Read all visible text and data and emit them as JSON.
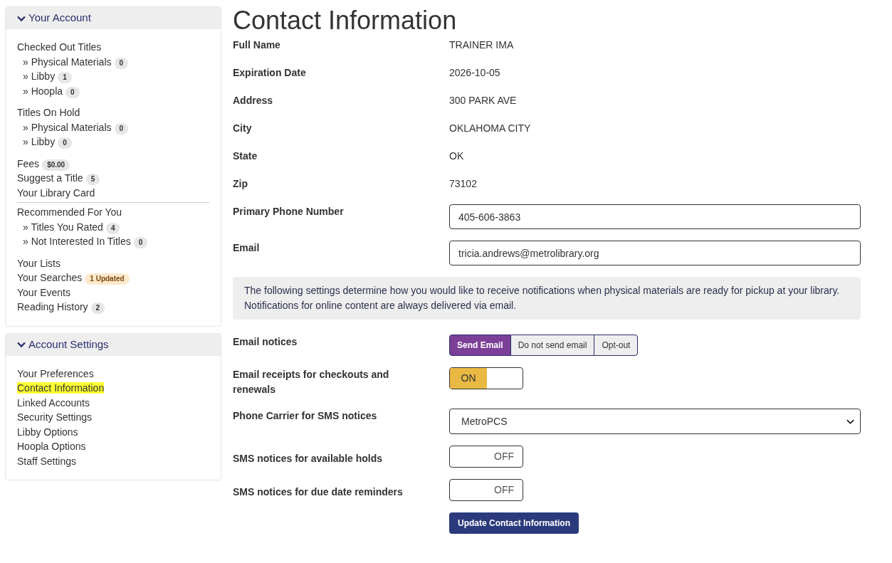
{
  "sidebar": [
    {
      "title": "Your Account",
      "expanded": true,
      "groups": [
        {
          "divider_before": false,
          "items": [
            {
              "label": "Checked Out Titles",
              "children": [
                {
                  "label": "» Physical Materials",
                  "badge": {
                    "text": "0",
                    "kind": "count"
                  }
                },
                {
                  "label": "» Libby",
                  "badge": {
                    "text": "1",
                    "kind": "count"
                  }
                },
                {
                  "label": "» Hoopla",
                  "badge": {
                    "text": "0",
                    "kind": "count"
                  }
                }
              ]
            }
          ]
        },
        {
          "divider_before": false,
          "items": [
            {
              "label": "Titles On Hold",
              "children": [
                {
                  "label": "» Physical Materials",
                  "badge": {
                    "text": "0",
                    "kind": "count"
                  }
                },
                {
                  "label": "» Libby",
                  "badge": {
                    "text": "0",
                    "kind": "count"
                  }
                }
              ]
            }
          ]
        },
        {
          "divider_before": false,
          "items": [
            {
              "label": "Fees",
              "badge": {
                "text": "$0.00",
                "kind": "count"
              }
            },
            {
              "label": "Suggest a Title",
              "badge": {
                "text": "5",
                "kind": "count"
              }
            },
            {
              "label": "Your Library Card"
            }
          ]
        },
        {
          "divider_before": true,
          "items": [
            {
              "label": "Recommended For You",
              "children": [
                {
                  "label": "» Titles You Rated",
                  "badge": {
                    "text": "4",
                    "kind": "count"
                  }
                },
                {
                  "label": "» Not Interested In Titles",
                  "badge": {
                    "text": "0",
                    "kind": "count"
                  }
                }
              ]
            }
          ]
        },
        {
          "divider_before": false,
          "items": [
            {
              "label": "Your Lists"
            },
            {
              "label": "Your Searches",
              "badge": {
                "text": "1 Updated",
                "kind": "alert"
              }
            },
            {
              "label": "Your Events"
            },
            {
              "label": "Reading History",
              "badge": {
                "text": "2",
                "kind": "count"
              }
            }
          ]
        }
      ]
    },
    {
      "title": "Account Settings",
      "expanded": true,
      "groups": [
        {
          "divider_before": false,
          "items": [
            {
              "label": "Your Preferences",
              "selected": false
            },
            {
              "label": "Contact Information",
              "selected": true
            },
            {
              "label": "Linked Accounts",
              "selected": false
            },
            {
              "label": "Security Settings",
              "selected": false
            },
            {
              "label": "Libby Options",
              "selected": false
            },
            {
              "label": "Hoopla Options",
              "selected": false
            },
            {
              "label": "Staff Settings",
              "selected": false
            }
          ]
        }
      ]
    }
  ],
  "main": {
    "title": "Contact Information",
    "info": [
      {
        "label": "Full Name",
        "value": "TRAINER IMA"
      },
      {
        "label": "Expiration Date",
        "value": "2026-10-05"
      },
      {
        "label": "Address",
        "value": "300 PARK AVE"
      },
      {
        "label": "City",
        "value": "OKLAHOMA CITY"
      },
      {
        "label": "State",
        "value": "OK"
      },
      {
        "label": "Zip",
        "value": "73102"
      }
    ],
    "fields": [
      {
        "label": "Primary Phone Number",
        "value": "405-606-3863"
      },
      {
        "label": "Email",
        "value": "tricia.andrews@metrolibrary.org"
      }
    ],
    "notice": "The following settings determine how you would like to receive notifications when physical materials are ready for pickup at your library. Notifications for online content are always delivered via email.",
    "settings": [
      {
        "kind": "segmented",
        "label": "Email notices",
        "options": [
          {
            "label": "Send Email",
            "selected": true
          },
          {
            "label": "Do not send email",
            "selected": false
          },
          {
            "label": "Opt-out",
            "selected": false
          }
        ]
      },
      {
        "kind": "toggle",
        "label": "Email receipts for checkouts and renewals",
        "on": true,
        "text": "ON"
      },
      {
        "kind": "select",
        "label": "Phone Carrier for SMS notices",
        "value": "MetroPCS"
      },
      {
        "kind": "toggle",
        "label": "SMS notices for available holds",
        "on": false,
        "text": "OFF"
      },
      {
        "kind": "toggle",
        "label": "SMS notices for due date reminders",
        "on": false,
        "text": "OFF"
      }
    ],
    "button": "Update Contact Information"
  }
}
